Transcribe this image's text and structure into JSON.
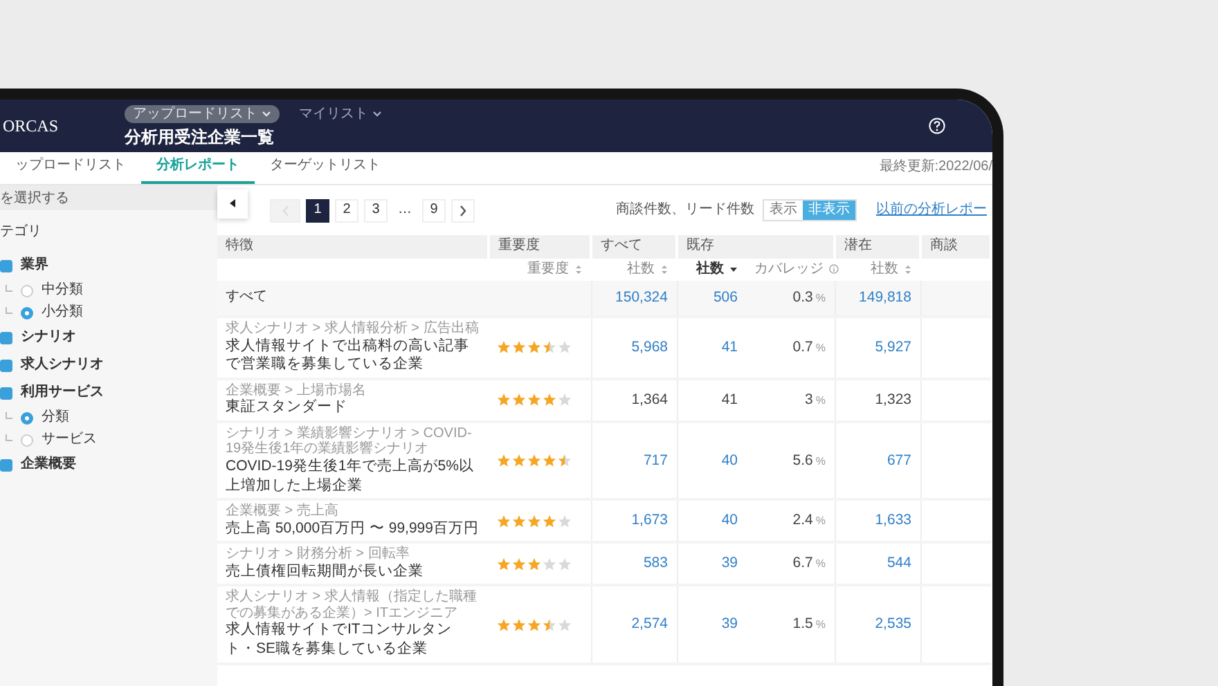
{
  "header": {
    "logo": "ORCAS",
    "list_menus": [
      {
        "label": "アップロードリスト",
        "selected": true
      },
      {
        "label": "マイリスト",
        "selected": false
      }
    ],
    "title": "分析用受注企業一覧"
  },
  "tabs": [
    {
      "label": "ップロードリスト",
      "selected": false
    },
    {
      "label": "分析レポート",
      "selected": true
    },
    {
      "label": "ターゲットリスト",
      "selected": false
    }
  ],
  "last_updated": "最終更新:2022/06/",
  "sidebar": {
    "search": {
      "placeholder": "を選択する"
    },
    "heading": "テゴリ",
    "items": [
      {
        "kind": "checkbox",
        "label": "業界",
        "checked": true,
        "children": [
          {
            "kind": "radio",
            "label": "中分類",
            "selected": false
          },
          {
            "kind": "radio",
            "label": "小分類",
            "selected": true
          }
        ]
      },
      {
        "kind": "checkbox",
        "label": "シナリオ",
        "checked": true
      },
      {
        "kind": "checkbox",
        "label": "求人シナリオ",
        "checked": true
      },
      {
        "kind": "checkbox",
        "label": "利用サービス",
        "checked": true,
        "children": [
          {
            "kind": "radio",
            "label": "分類",
            "selected": true
          },
          {
            "kind": "radio",
            "label": "サービス",
            "selected": false
          }
        ]
      },
      {
        "kind": "checkbox",
        "label": "企業概要",
        "checked": true
      }
    ]
  },
  "pagination": {
    "previous": {
      "disabled": true
    },
    "items": [
      {
        "kind": "page",
        "label": "1",
        "selected": true
      },
      {
        "kind": "page",
        "label": "2",
        "selected": false
      },
      {
        "kind": "page",
        "label": "3",
        "selected": false
      },
      {
        "kind": "ellipsis",
        "label": "…"
      },
      {
        "kind": "page",
        "label": "9",
        "selected": false
      }
    ],
    "next": {
      "disabled": false
    }
  },
  "count_toggle": {
    "label": "商談件数、リード件数",
    "options": [
      {
        "label": "表示",
        "selected": false
      },
      {
        "label": "非表示",
        "selected": true
      }
    ]
  },
  "previous_report_link": "以前の分析レポー",
  "table": {
    "columns": [
      {
        "label": "特徴"
      },
      {
        "label": "重要度",
        "sub": [
          {
            "label": "重要度",
            "sortable": true,
            "sorted": false
          }
        ]
      },
      {
        "label": "すべて",
        "sub": [
          {
            "label": "社数",
            "sortable": true,
            "sorted": false
          }
        ]
      },
      {
        "label": "既存",
        "sub": [
          {
            "label": "社数",
            "sortable": true,
            "sorted": true
          },
          {
            "label": "カバレッジ",
            "info": true
          }
        ]
      },
      {
        "label": "潜在",
        "sub": [
          {
            "label": "社数",
            "sortable": true,
            "sorted": false
          }
        ]
      },
      {
        "label": "商談"
      }
    ],
    "summary_row": {
      "label": "すべて",
      "all": "150,324",
      "existing": "506",
      "coverage": {
        "value": "0.3",
        "unit": "%"
      },
      "potential": "149,818",
      "linked": true
    },
    "rows": [
      {
        "path": "求人シナリオ > 求人情報分析 > 広告出稿",
        "feature": "求人情報サイトで出稿料の高い記事で営業職を募集している企業",
        "stars": 3.5,
        "all": "5,968",
        "existing": "41",
        "coverage": {
          "value": "0.7",
          "unit": "%"
        },
        "potential": "5,927",
        "linked": true
      },
      {
        "path": "企業概要 > 上場市場名",
        "feature": "東証スタンダード",
        "stars": 4,
        "all": "1,364",
        "existing": "41",
        "coverage": {
          "value": "3",
          "unit": "%"
        },
        "potential": "1,323",
        "linked": false
      },
      {
        "path": "シナリオ > 業績影響シナリオ > COVID-19発生後1年の業績影響シナリオ",
        "feature": "COVID-19発生後1年で売上高が5%以上増加した上場企業",
        "stars": 4.5,
        "all": "717",
        "existing": "40",
        "coverage": {
          "value": "5.6",
          "unit": "%"
        },
        "potential": "677",
        "linked": true
      },
      {
        "path": "企業概要 > 売上高",
        "feature": "売上高 50,000百万円 〜 99,999百万円",
        "stars": 4,
        "all": "1,673",
        "existing": "40",
        "coverage": {
          "value": "2.4",
          "unit": "%"
        },
        "potential": "1,633",
        "linked": true
      },
      {
        "path": "シナリオ > 財務分析 > 回転率",
        "feature": "売上債権回転期間が長い企業",
        "stars": 3,
        "all": "583",
        "existing": "39",
        "coverage": {
          "value": "6.7",
          "unit": "%"
        },
        "potential": "544",
        "linked": true
      },
      {
        "path": "求人シナリオ > 求人情報（指定した職種での募集がある企業）> ITエンジニア",
        "feature": "求人情報サイトでITコンサルタント・SE職を募集している企業",
        "stars": 3.5,
        "all": "2,574",
        "existing": "39",
        "coverage": {
          "value": "1.5",
          "unit": "%"
        },
        "potential": "2,535",
        "linked": true
      }
    ]
  }
}
